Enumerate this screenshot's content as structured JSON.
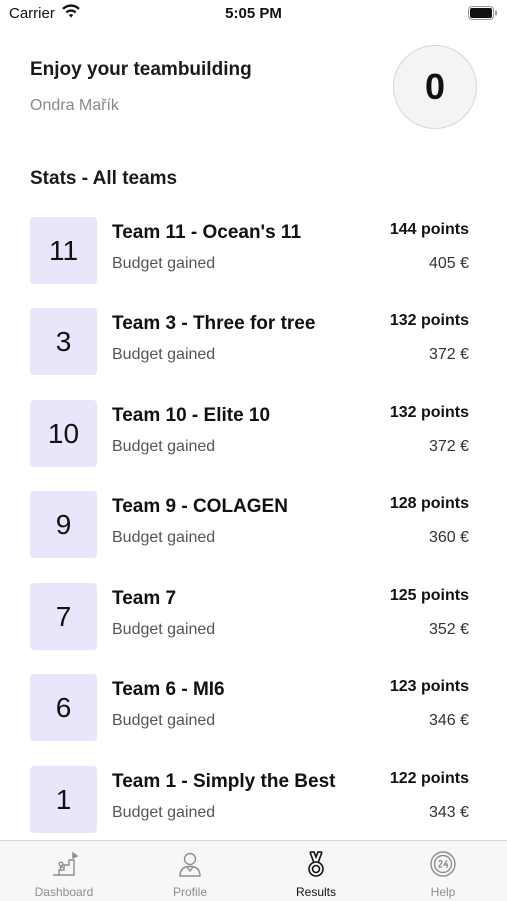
{
  "status_bar": {
    "carrier": "Carrier",
    "time": "5:05 PM"
  },
  "header": {
    "title": "Enjoy your teambuilding",
    "user_name": "Ondra Mařík",
    "avatar_value": "0"
  },
  "section_title": "Stats - All teams",
  "teams": [
    {
      "number": "11",
      "name": "Team 11 - Ocean's 11",
      "budget_label": "Budget gained",
      "points": "144 points",
      "budget": "405 €"
    },
    {
      "number": "3",
      "name": "Team 3 - Three for tree",
      "budget_label": "Budget gained",
      "points": "132 points",
      "budget": "372 €"
    },
    {
      "number": "10",
      "name": "Team 10 - Elite 10",
      "budget_label": "Budget gained",
      "points": "132 points",
      "budget": "372 €"
    },
    {
      "number": "9",
      "name": "Team 9 - COLAGEN",
      "budget_label": "Budget gained",
      "points": "128 points",
      "budget": "360 €"
    },
    {
      "number": "7",
      "name": "Team 7",
      "budget_label": "Budget gained",
      "points": "125 points",
      "budget": "352 €"
    },
    {
      "number": "6",
      "name": "Team 6 - MI6",
      "budget_label": "Budget gained",
      "points": "123 points",
      "budget": "346 €"
    },
    {
      "number": "1",
      "name": "Team 1 - Simply the Best",
      "budget_label": "Budget gained",
      "points": "122 points",
      "budget": "343 €"
    }
  ],
  "tabbar": {
    "items": [
      {
        "label": "Dashboard",
        "icon": "stairs-icon"
      },
      {
        "label": "Profile",
        "icon": "person-icon"
      },
      {
        "label": "Results",
        "icon": "medal-icon",
        "active": true
      },
      {
        "label": "Help",
        "icon": "help-24-icon"
      }
    ]
  },
  "colors": {
    "accent_tile": "#e8e6fb",
    "tab_active": "#111111",
    "tab_inactive": "#8e8e8e"
  }
}
